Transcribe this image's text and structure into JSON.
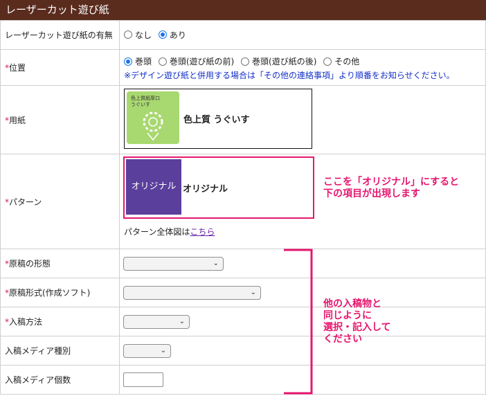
{
  "header": {
    "title": "レーザーカット遊び紙"
  },
  "rows": {
    "presence": {
      "label": "レーザーカット遊び紙の有無",
      "options": [
        "なし",
        "あり"
      ],
      "selected": "あり"
    },
    "position": {
      "required_mark": "*",
      "label": "位置",
      "options": [
        "巻頭",
        "巻頭(遊び紙の前)",
        "巻頭(遊び紙の後)",
        "その他"
      ],
      "selected": "巻頭",
      "note": "※デザイン遊び紙と併用する場合は「その他の連絡事項」より順番をお知らせください。"
    },
    "paper": {
      "required_mark": "*",
      "label": "用紙",
      "thumb_text_line1": "色上質紙厚口",
      "thumb_text_line2": "うぐいす",
      "name": "色上質 うぐいす"
    },
    "pattern": {
      "required_mark": "*",
      "label": "パターン",
      "thumb_text": "オリジナル",
      "name": "オリジナル",
      "full_view_prefix": "パターン全体図は",
      "full_view_link": "こちら"
    },
    "manuscript_form": {
      "required_mark": "*",
      "label": "原稿の形態"
    },
    "manuscript_format": {
      "required_mark": "*",
      "label": "原稿形式(作成ソフト)"
    },
    "submission_method": {
      "required_mark": "*",
      "label": "入稿方法"
    },
    "media_type": {
      "label": "入稿メディア種別"
    },
    "media_count": {
      "label": "入稿メディア個数",
      "value": ""
    }
  },
  "annotations": {
    "callout1_line1": "ここを「オリジナル」にすると",
    "callout1_line2": "下の項目が出現します",
    "callout2_line1": "他の入稿物と",
    "callout2_line2": "同じように",
    "callout2_line3": "選択・記入して",
    "callout2_line4": "ください"
  },
  "colors": {
    "header_bg": "#5a2c1e",
    "required": "#e0184a",
    "note": "#1431c8",
    "annotation": "#e6166e",
    "pattern_thumb": "#5a3f9c",
    "paper_thumb": "#a8d870"
  }
}
